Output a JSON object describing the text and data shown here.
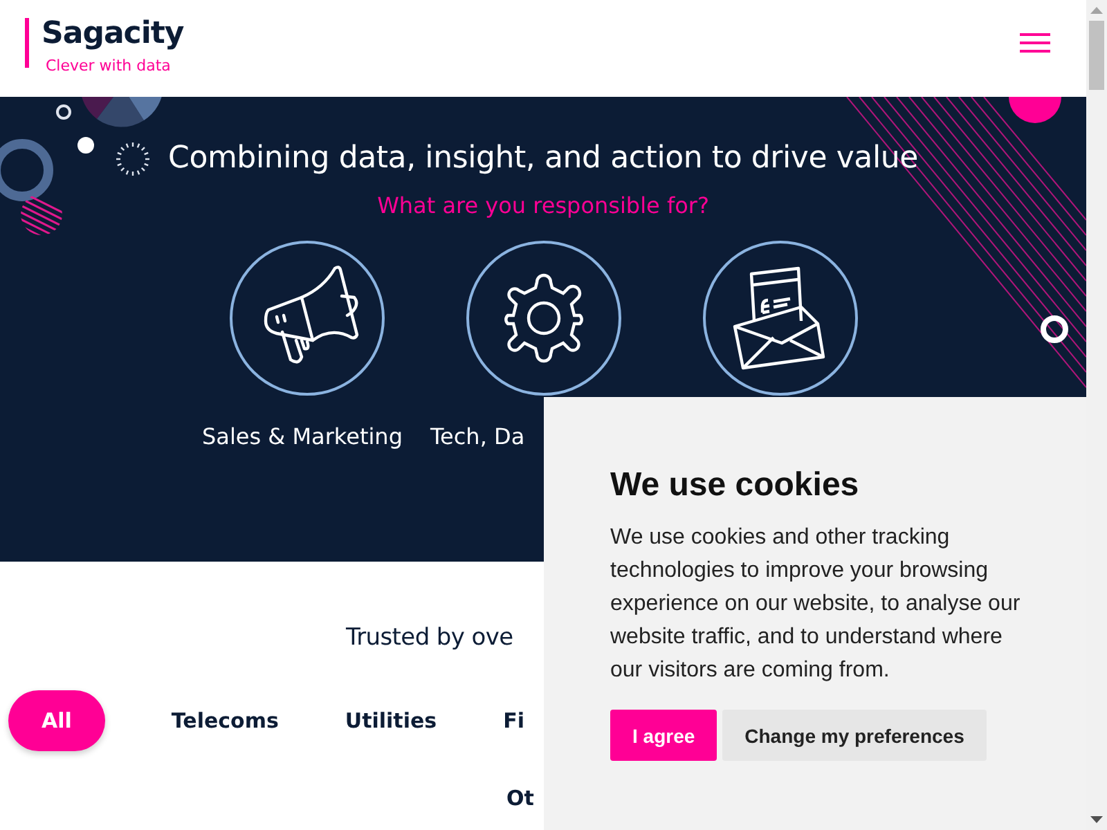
{
  "header": {
    "logo": "Sagacity",
    "tagline": "Clever with data"
  },
  "hero": {
    "title": "Combining data, insight, and action to drive value",
    "subtitle": "What are you responsible for?",
    "categories": [
      {
        "kind": "megaphone",
        "label": "Sales & Marketing"
      },
      {
        "kind": "gear",
        "label": "Tech, Da"
      },
      {
        "kind": "envelope"
      }
    ]
  },
  "clients": {
    "heading": "Trusted by ove",
    "filters": [
      {
        "label": "All",
        "selected": true
      },
      {
        "label": "Telecoms",
        "selected": false
      },
      {
        "label": "Utilities",
        "selected": false
      },
      {
        "label": "Fi",
        "selected": false
      },
      {
        "label": "Ot",
        "selected": false
      }
    ]
  },
  "cookie_banner": {
    "title": "We use cookies",
    "text": "We use cookies and other tracking technologies to improve your browsing experience on our website, to analyse our website traffic, and to understand where our visitors are coming from.",
    "buttons": [
      {
        "label": "I agree",
        "kind": "primary"
      },
      {
        "label": "Change my preferences",
        "kind": "secondary"
      }
    ]
  }
}
